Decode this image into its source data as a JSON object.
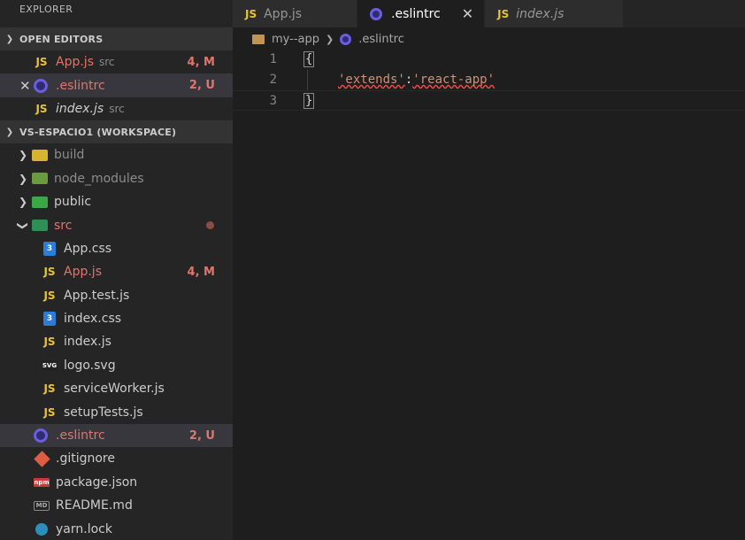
{
  "sidebar": {
    "title": "EXPLORER",
    "open_editors": {
      "header": "OPEN EDITORS",
      "items": [
        {
          "name": "App.js",
          "desc": "src",
          "badge": "4, M"
        },
        {
          "name": ".eslintrc",
          "desc": "",
          "badge": "2, U"
        },
        {
          "name": "index.js",
          "desc": "src",
          "badge": ""
        }
      ]
    },
    "workspace": {
      "header": "VS-ESPACIO1 (WORKSPACE)",
      "items": [
        {
          "name": "build"
        },
        {
          "name": "node_modules"
        },
        {
          "name": "public"
        },
        {
          "name": "src"
        },
        {
          "name": "App.css"
        },
        {
          "name": "App.js",
          "badge": "4, M"
        },
        {
          "name": "App.test.js"
        },
        {
          "name": "index.css"
        },
        {
          "name": "index.js"
        },
        {
          "name": "logo.svg"
        },
        {
          "name": "serviceWorker.js"
        },
        {
          "name": "setupTests.js"
        },
        {
          "name": ".eslintrc",
          "badge": "2, U"
        },
        {
          "name": ".gitignore"
        },
        {
          "name": "package.json"
        },
        {
          "name": "README.md"
        },
        {
          "name": "yarn.lock"
        }
      ]
    }
  },
  "icons": {
    "js": "JS",
    "css": "3",
    "svg": "SVG",
    "npm": "npm",
    "md": "MD"
  },
  "editor": {
    "tabs": [
      {
        "label": "App.js"
      },
      {
        "label": ".eslintrc"
      },
      {
        "label": "index.js"
      }
    ],
    "breadcrumb": {
      "folder": "my--app",
      "file": ".eslintrc"
    },
    "lines": [
      {
        "number": "1",
        "open": "{"
      },
      {
        "number": "2",
        "key": "'extends'",
        "colon": ":",
        "value": "'react-app'"
      },
      {
        "number": "3",
        "close": "}"
      }
    ]
  },
  "colors": {
    "sidebar_bg": "#252526",
    "editor_bg": "#1e1e1e",
    "modified": "#e2756a",
    "string": "#ce9178",
    "js_yellow": "#e8c33a",
    "eslint_purple": "#6c5ce0"
  }
}
